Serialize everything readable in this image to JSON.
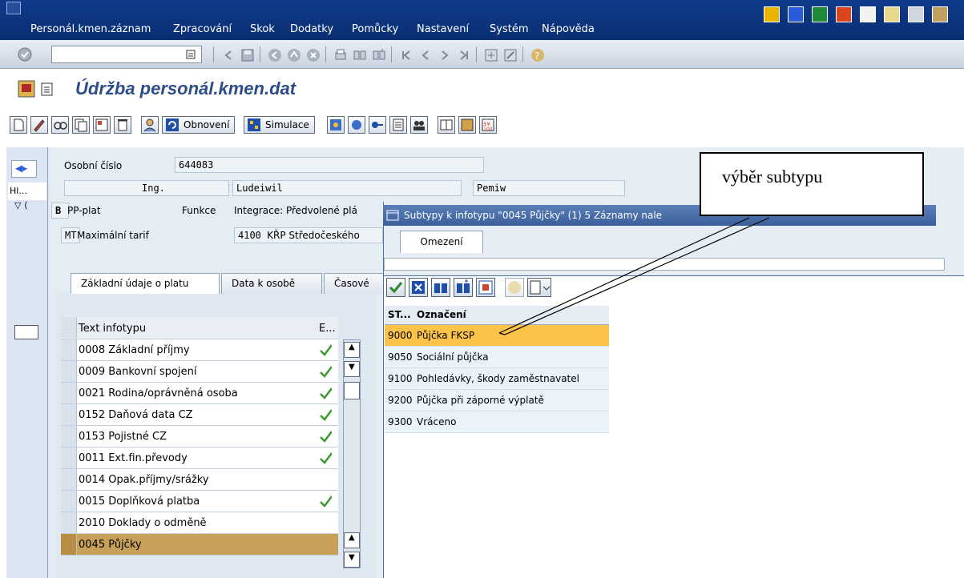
{
  "menu": {
    "items": [
      "Personál.kmen.záznam",
      "Zpracování",
      "Skok",
      "Dodatky",
      "Pomůcky",
      "Nastavení",
      "Systém",
      "Nápověda"
    ]
  },
  "title": "Údržba personál.kmen.dat",
  "app_toolbar": {
    "refresh_label": "Obnovení",
    "simulation_label": "Simulace"
  },
  "header": {
    "personal_number_label": "Osobní číslo",
    "personal_number": "644083",
    "title_prefix": "Ing.",
    "first_name": "Ludeiwil",
    "last_name": "Pemiw",
    "pp_code": "B",
    "pp_label": "PP-plat",
    "function_label": "Funkce",
    "function_value": "Integrace: Předvolené plá",
    "mt_code": "MT",
    "mt_label": "Maximální tarif",
    "tariff_code": "4100",
    "tariff_text": "KŘP Středočeského"
  },
  "left_panel": {
    "tab_label": "Hl..."
  },
  "tabs": [
    "Základní údaje o platu",
    "Data k osobě",
    "Časové"
  ],
  "infotype_table": {
    "col_text": "Text infotypu",
    "col_e": "E...",
    "rows": [
      {
        "text": "0008 Základní příjmy",
        "checked": true
      },
      {
        "text": "0009 Bankovní spojení",
        "checked": true
      },
      {
        "text": "0021 Rodina/oprávněná osoba",
        "checked": true
      },
      {
        "text": "0152 Daňová data CZ",
        "checked": true
      },
      {
        "text": "0153 Pojistné CZ",
        "checked": true
      },
      {
        "text": "0011 Ext.fin.převody",
        "checked": true
      },
      {
        "text": "0014 Opak.příjmy/srážky",
        "checked": false
      },
      {
        "text": "0015 Doplňková platba",
        "checked": true
      },
      {
        "text": "2010 Doklady o odměně",
        "checked": false
      },
      {
        "text": "0045 Půjčky",
        "checked": false,
        "selected": true
      }
    ]
  },
  "popup": {
    "title": "Subtypy k infotypu \"0045 Půjčky\" (1)   5 Záznamy nale",
    "tab_label": "Omezení",
    "col_code": "ST...",
    "col_name": "Označení",
    "rows": [
      {
        "code": "9000",
        "name": "Půjčka FKSP",
        "selected": true
      },
      {
        "code": "9050",
        "name": "Sociální půjčka"
      },
      {
        "code": "9100",
        "name": "Pohledávky, škody zaměstnavatel"
      },
      {
        "code": "9200",
        "name": "Půjčka při záporné výplatě"
      },
      {
        "code": "9300",
        "name": "Vráceno"
      }
    ]
  },
  "callout": "výběr subtypu"
}
